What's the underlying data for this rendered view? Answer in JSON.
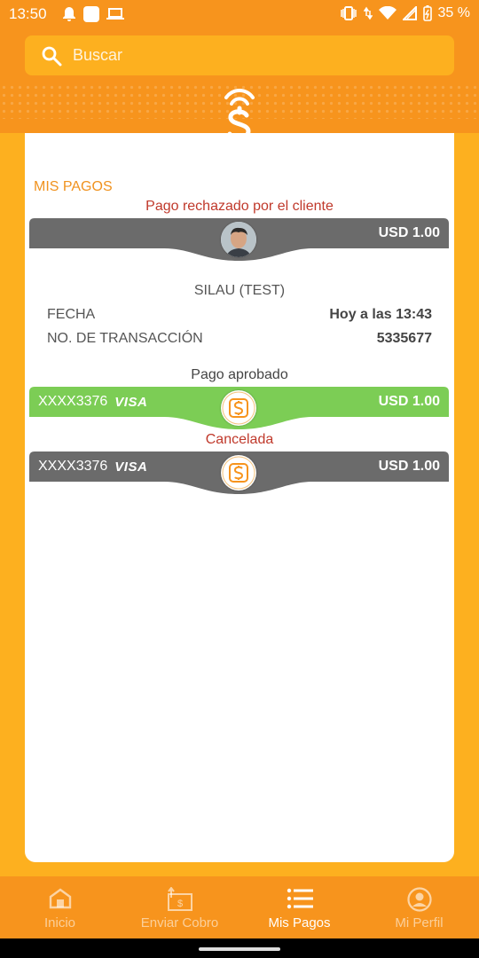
{
  "status_bar": {
    "time": "13:50",
    "battery": "35 %"
  },
  "search": {
    "placeholder": "Buscar"
  },
  "section_title": "MIS PAGOS",
  "payments": [
    {
      "status": "Pago rechazado por el cliente",
      "amount": "USD 1.00",
      "band_color": "#6b6b6b",
      "status_color": "#c0392b"
    },
    {
      "status": "Pago aprobado",
      "card": "XXXX3376",
      "card_brand": "VISA",
      "amount": "USD 1.00",
      "band_color": "#7ccd55",
      "status_color": "#444444"
    },
    {
      "status": "Cancelada",
      "card": "XXXX3376",
      "card_brand": "VISA",
      "amount": "USD 1.00",
      "band_color": "#6b6b6b",
      "status_color": "#c0392b"
    }
  ],
  "details": {
    "name": "SILAU (TEST)",
    "fecha_label": "FECHA",
    "fecha_value": "Hoy a las 13:43",
    "transaccion_label": "NO. DE TRANSACCIÓN",
    "transaccion_value": "5335677"
  },
  "bottom_nav": [
    {
      "label": "Inicio",
      "icon": "home-icon",
      "active": false
    },
    {
      "label": "Enviar Cobro",
      "icon": "send-charge-icon",
      "active": false
    },
    {
      "label": "Mis Pagos",
      "icon": "list-icon",
      "active": true
    },
    {
      "label": "Mi Perfil",
      "icon": "profile-icon",
      "active": false
    }
  ],
  "colors": {
    "primary": "#f7941d",
    "secondary": "#fdb01f",
    "approved": "#7ccd55",
    "neutral_band": "#6b6b6b"
  }
}
